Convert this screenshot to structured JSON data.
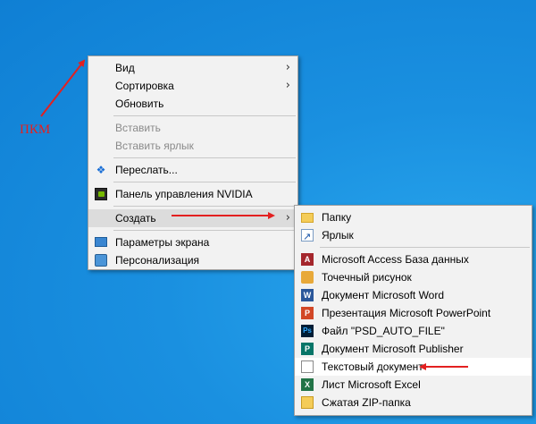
{
  "annotation": {
    "label": "ПКМ",
    "color": "#e32020"
  },
  "context_menu": {
    "items": [
      {
        "label": "Вид",
        "submenu": true
      },
      {
        "label": "Сортировка",
        "submenu": true
      },
      {
        "label": "Обновить"
      },
      {
        "label": "Вставить",
        "disabled": true
      },
      {
        "label": "Вставить ярлык",
        "disabled": true
      },
      {
        "label": "Переслать...",
        "icon": "dropbox-icon"
      },
      {
        "label": "Панель управления NVIDIA",
        "icon": "nvidia-icon"
      },
      {
        "label": "Создать",
        "submenu": true,
        "highlighted": true
      },
      {
        "label": "Параметры экрана",
        "icon": "display-settings-icon"
      },
      {
        "label": "Персонализация",
        "icon": "personalization-icon"
      }
    ]
  },
  "create_submenu": {
    "items": [
      {
        "label": "Папку",
        "icon": "folder-icon"
      },
      {
        "label": "Ярлык",
        "icon": "shortcut-icon"
      },
      {
        "label": "Microsoft Access База данных",
        "icon": "access-icon",
        "icon_letter": "A"
      },
      {
        "label": "Точечный рисунок",
        "icon": "bitmap-icon"
      },
      {
        "label": "Документ Microsoft Word",
        "icon": "word-icon",
        "icon_letter": "W"
      },
      {
        "label": "Презентация Microsoft PowerPoint",
        "icon": "powerpoint-icon",
        "icon_letter": "P"
      },
      {
        "label": "Файл \"PSD_AUTO_FILE\"",
        "icon": "photoshop-icon",
        "icon_letter": "Ps"
      },
      {
        "label": "Документ Microsoft Publisher",
        "icon": "publisher-icon",
        "icon_letter": "P"
      },
      {
        "label": "Текстовый документ",
        "icon": "text-document-icon",
        "active": true
      },
      {
        "label": "Лист Microsoft Excel",
        "icon": "excel-icon",
        "icon_letter": "X"
      },
      {
        "label": "Сжатая ZIP-папка",
        "icon": "zip-folder-icon"
      }
    ]
  },
  "submenu_arrow": "›"
}
